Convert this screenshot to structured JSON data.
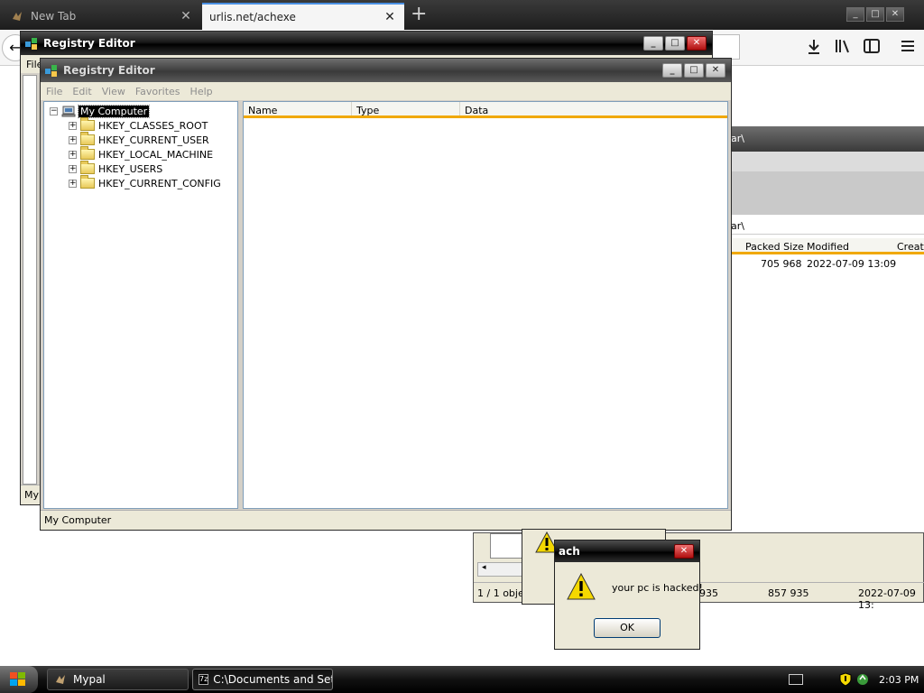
{
  "browser": {
    "tabs": [
      {
        "title": "New Tab",
        "close": "✕"
      },
      {
        "title": "urlis.net/achexe",
        "close": "✕"
      }
    ],
    "new_tab": "+",
    "back": "←"
  },
  "registry_back": {
    "title": "Registry Editor",
    "menu_first": "File",
    "status": "My"
  },
  "registry": {
    "title": "Registry Editor",
    "menu": [
      "File",
      "Edit",
      "View",
      "Favorites",
      "Help"
    ],
    "root": "My Computer",
    "keys": [
      "HKEY_CLASSES_ROOT",
      "HKEY_CURRENT_USER",
      "HKEY_LOCAL_MACHINE",
      "HKEY_USERS",
      "HKEY_CURRENT_CONFIG"
    ],
    "columns": [
      "Name",
      "Type",
      "Data"
    ],
    "status": "My Computer",
    "expander": "+"
  },
  "file_manager": {
    "path_tail_1": "ar\\",
    "path_tail_2": "ar\\",
    "columns": [
      "Packed Size",
      "Modified",
      "Create"
    ],
    "row": {
      "packed_size": "705 968",
      "modified": "2022-07-09 13:09"
    },
    "status": {
      "objects": "1 / 1 objec",
      "size": "935",
      "packed": "857 935",
      "date": "2022-07-09 13:"
    }
  },
  "dialog": {
    "title": "ach",
    "message": "your pc is hacked!",
    "ok": "OK",
    "close": "✕"
  },
  "taskbar": {
    "items": [
      "Mypal",
      "C:\\Documents and Set..."
    ],
    "clock": "2:03 PM"
  },
  "colors": {
    "column_underline": "#f0a800",
    "close_red": "#c81a1a",
    "warning_yellow": "#f5d800"
  }
}
